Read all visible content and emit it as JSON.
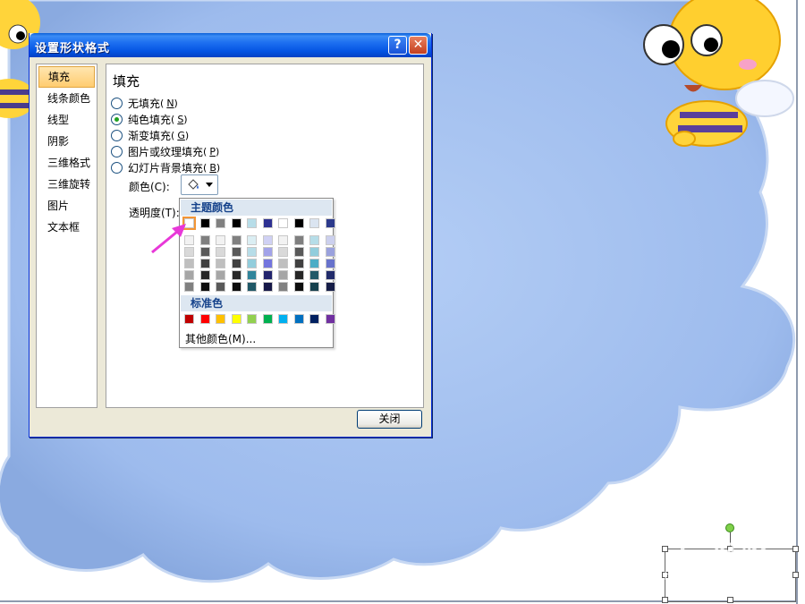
{
  "dialog": {
    "title": "设置形状格式",
    "help_label": "?",
    "close_x_label": "✕",
    "close_button": "关闭"
  },
  "nav": {
    "items": [
      {
        "label": "填充",
        "active": true
      },
      {
        "label": "线条颜色"
      },
      {
        "label": "线型"
      },
      {
        "label": "阴影"
      },
      {
        "label": "三维格式"
      },
      {
        "label": "三维旋转"
      },
      {
        "label": "图片"
      },
      {
        "label": "文本框"
      }
    ]
  },
  "fill": {
    "section_title": "填充",
    "options": [
      {
        "label": "无填充",
        "key": "N",
        "checked": false
      },
      {
        "label": "纯色填充",
        "key": "S",
        "checked": true
      },
      {
        "label": "渐变填充",
        "key": "G",
        "checked": false
      },
      {
        "label": "图片或纹理填充",
        "key": "P",
        "checked": false
      },
      {
        "label": "幻灯片背景填充",
        "key": "B",
        "checked": false
      }
    ],
    "color_label": "颜色(C):",
    "transparency_label": "透明度(T):"
  },
  "picker": {
    "theme_header": "主题颜色",
    "standard_header": "标准色",
    "more_colors": "其他颜色(M)...",
    "theme_colors": [
      "#ffffff",
      "#000000",
      "#808080",
      "#000000",
      "#b7dde8",
      "#2e3192",
      "#ffffff",
      "#000000",
      "#dbe5f1",
      "#2c3a8c"
    ],
    "theme_tints": [
      [
        "#f2f2f2",
        "#d9d9d9",
        "#bfbfbf",
        "#a6a6a6",
        "#808080"
      ],
      [
        "#7f7f7f",
        "#595959",
        "#404040",
        "#262626",
        "#0d0d0d"
      ],
      [
        "#f2f2f2",
        "#d9d9d9",
        "#bfbfbf",
        "#a6a6a6",
        "#595959"
      ],
      [
        "#808080",
        "#595959",
        "#404040",
        "#262626",
        "#0d0d0d"
      ],
      [
        "#dbeef3",
        "#b7dde8",
        "#92cddc",
        "#31859b",
        "#205867"
      ],
      [
        "#d0d1f4",
        "#a2a3e9",
        "#7375de",
        "#22246d",
        "#161848"
      ],
      [
        "#f2f2f2",
        "#d9d9d9",
        "#bfbfbf",
        "#a6a6a6",
        "#808080"
      ],
      [
        "#7f7f7f",
        "#595959",
        "#404040",
        "#262626",
        "#0d0d0d"
      ],
      [
        "#b6dde8",
        "#92cddc",
        "#4bacc6",
        "#215868",
        "#16404d"
      ],
      [
        "#ccd0ee",
        "#9aa1dd",
        "#6772cc",
        "#212b6a",
        "#161d47"
      ]
    ],
    "standard_colors": [
      "#c00000",
      "#ff0000",
      "#ffc000",
      "#ffff00",
      "#92d050",
      "#00b050",
      "#00b0f0",
      "#0070c0",
      "#002060",
      "#7030a0"
    ]
  },
  "watermark": {
    "line1": "Bai du 经验",
    "line2": "jingyan.baidu.com"
  },
  "colors": {
    "cloud": "#a8c4f0",
    "cloud_shade": "#8faee6",
    "annotation_arrow": "#e838d8"
  }
}
